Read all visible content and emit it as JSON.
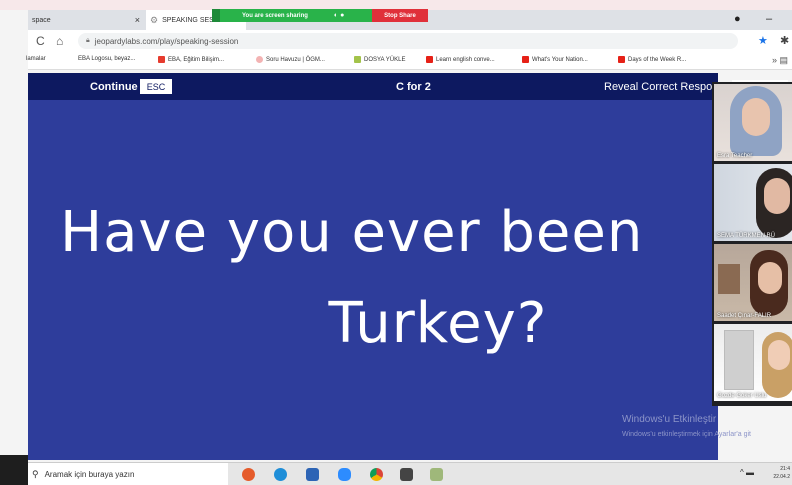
{
  "browser": {
    "tabs": [
      {
        "label": "space"
      },
      {
        "label": "SPEAKING SES"
      }
    ],
    "tab_close": "×",
    "url": "jeopardylabs.com/play/speaking-session",
    "bookmarks": [
      {
        "label": "lamalar"
      },
      {
        "label": "EBA Logosu, beyaz..."
      },
      {
        "label": "EBA, Eğitim Bilişim..."
      },
      {
        "label": "Soru Havuzu | ÖGM..."
      },
      {
        "label": "DOSYA YÜKLE"
      },
      {
        "label": "Learn english conve..."
      },
      {
        "label": "What's Your Nation..."
      },
      {
        "label": "Days of the Week R..."
      }
    ]
  },
  "screen_share": {
    "message": "You are screen sharing",
    "stop_label": "Stop Share"
  },
  "game": {
    "continue_label": "Continue",
    "esc_label": "ESC",
    "score_label": "C for 2",
    "reveal_label": "Reveal Correct Respo",
    "question_line_1": "Have you ever been",
    "question_line_2": "Turkey?"
  },
  "participants": [
    {
      "name": "Esra Teacher"
    },
    {
      "name": "SEMA TÜRKMEN BÜ"
    },
    {
      "name": "Saadet Çınar-FALIR"
    },
    {
      "name": "Gozde Goker Uslu"
    }
  ],
  "watermark": {
    "title": "Windows'u Etkinleştir",
    "subtitle": "Windows'u etkinleştirmek için Ayarlar'a git"
  },
  "taskbar": {
    "search_placeholder": "Aramak için buraya yazın",
    "clock_time": "21:4",
    "clock_date": "22.04.2"
  },
  "colors": {
    "app_header": "#0d1960",
    "question_bg": "#2e3d9b",
    "share_green": "#29b34a",
    "stop_red": "#e0303a"
  }
}
